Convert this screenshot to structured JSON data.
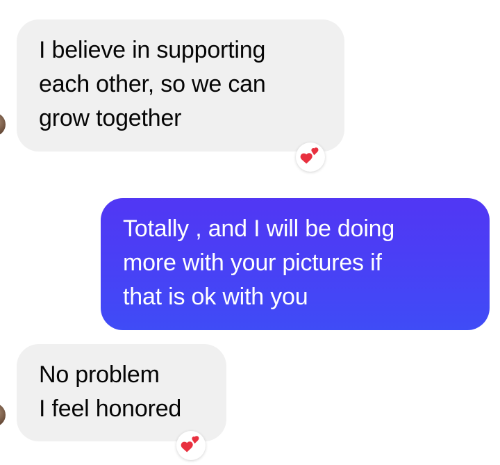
{
  "messages": [
    {
      "direction": "incoming",
      "lines": [
        "I believe in supporting",
        "each other, so we can",
        "grow together"
      ],
      "reaction": "two-hearts-icon"
    },
    {
      "direction": "outgoing",
      "lines": [
        "Totally , and I will be doing",
        "more with your pictures if",
        "that is ok with you"
      ]
    },
    {
      "direction": "incoming",
      "lines": [
        "No problem",
        "I feel honored"
      ],
      "reaction": "two-hearts-icon"
    }
  ],
  "colors": {
    "incoming_bubble": "#f0f0f0",
    "incoming_text": "#050505",
    "outgoing_bubble_top": "#5137f4",
    "outgoing_bubble_bottom": "#3f4cf6",
    "outgoing_text": "#ffffff",
    "heart": "#e8303f"
  }
}
